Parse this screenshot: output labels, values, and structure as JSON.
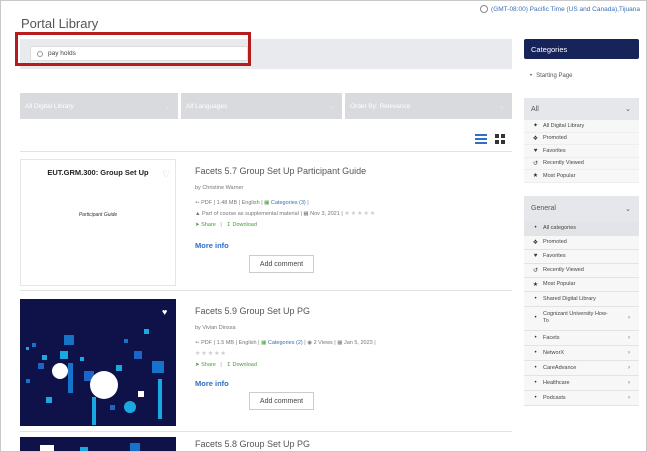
{
  "header": {
    "timezone": "(GMT-08:00) Pacific Time (US and Canada),Tijuana",
    "title": "Portal Library"
  },
  "search": {
    "value": "pay holds"
  },
  "filters": [
    {
      "label": "All Digital Library"
    },
    {
      "label": "All Languages"
    },
    {
      "label": "Order By: Relevance"
    }
  ],
  "results": [
    {
      "thumb_title": "EUT.GRM.300: Group Set Up",
      "thumb_subtitle": "Participant Guide",
      "title": "Facets 5.7 Group Set Up Participant Guide",
      "author": "by Christine Warner",
      "pdf": "PDF",
      "size": "1.48 MB",
      "language": "English",
      "categories": "Categories (3)",
      "supplemental": "Part of course as supplemental material",
      "date": "Nov 3, 2021",
      "share": "Share",
      "download": "Download",
      "more_info": "More info",
      "add_comment": "Add comment"
    },
    {
      "title": "Facets 5.9 Group Set Up PG",
      "author": "by Vivian Dinssa",
      "pdf": "PDF",
      "size": "1.5 MB",
      "language": "English",
      "categories": "Categories (2)",
      "views": "2 Views",
      "date": "Jan 5, 2023",
      "share": "Share",
      "download": "Download",
      "more_info": "More info",
      "add_comment": "Add comment"
    },
    {
      "title": "Facets 5.8 Group Set Up PG"
    }
  ],
  "sidebar": {
    "categories_heading": "Categories",
    "starting_page": "Starting Page",
    "all_heading": "All",
    "all_items": [
      {
        "label": "All Digital Library",
        "icon": "pin-icon"
      },
      {
        "label": "Promoted",
        "icon": "badge-icon"
      },
      {
        "label": "Favorites",
        "icon": "heart-icon"
      },
      {
        "label": "Recently Viewed",
        "icon": "history-icon"
      },
      {
        "label": "Most Popular",
        "icon": "star-icon"
      }
    ],
    "general_heading": "General",
    "general_items": [
      {
        "label": "All categories"
      },
      {
        "label": "Promoted"
      },
      {
        "label": "Favorites"
      },
      {
        "label": "Recently Viewed"
      },
      {
        "label": "Most Popular"
      },
      {
        "label": "Shared Digital Library"
      },
      {
        "label": "Cognizant University How-To"
      },
      {
        "label": "Facets"
      },
      {
        "label": "NetworX"
      },
      {
        "label": "CareAdvance"
      },
      {
        "label": "Healthcare"
      },
      {
        "label": "Podcasts"
      }
    ]
  },
  "colors": {
    "accent_blue": "#2f6fc4",
    "sidebar_heading": "#16245a",
    "highlight_red": "#b81b1b",
    "action_green": "#4a9b3a"
  }
}
